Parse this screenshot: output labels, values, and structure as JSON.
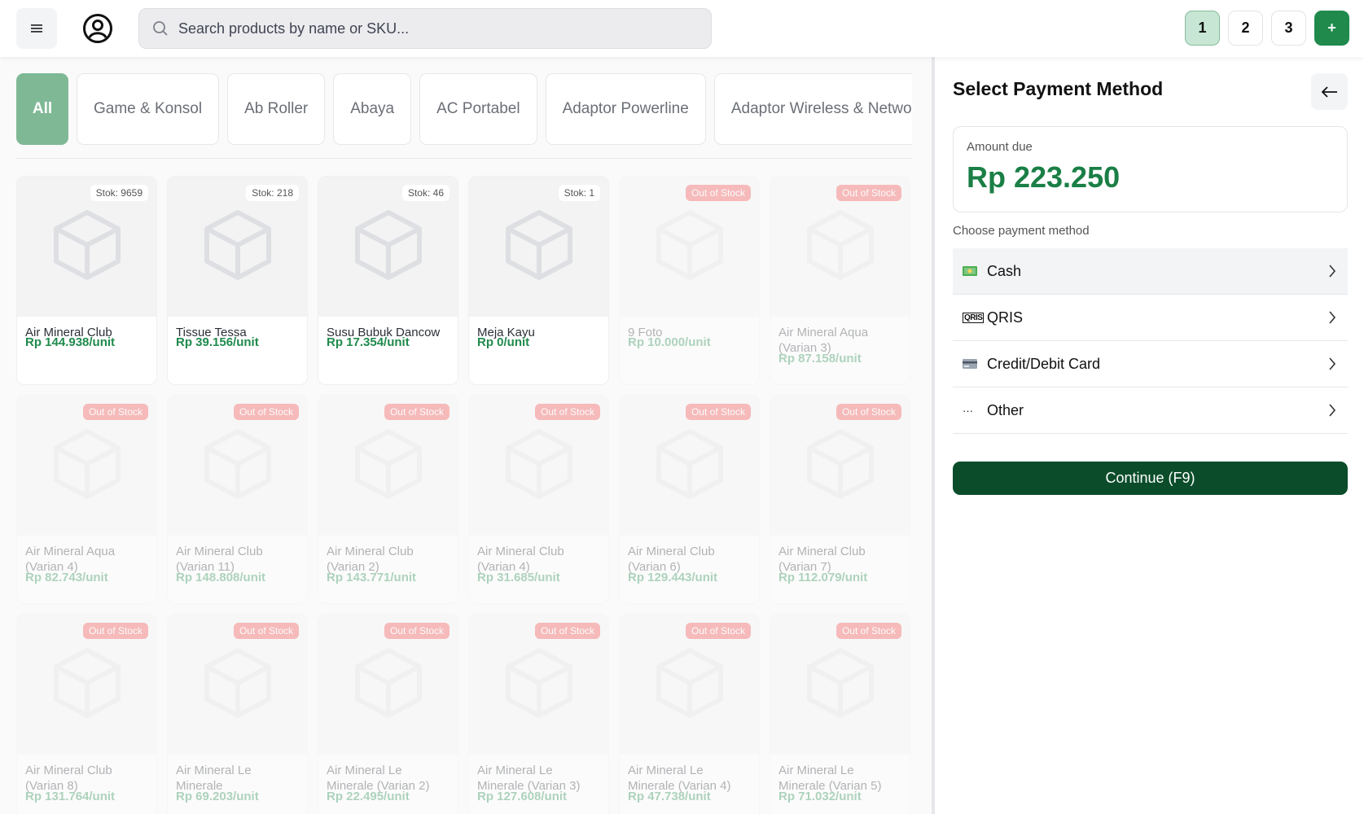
{
  "header": {
    "search_placeholder": "Search products by name or SKU...",
    "tabs": [
      {
        "label": "1",
        "active": true
      },
      {
        "label": "2"
      },
      {
        "label": "3"
      },
      {
        "label": "+"
      }
    ]
  },
  "categories": [
    "All",
    "Game & Konsol",
    "Ab Roller",
    "Abaya",
    "AC Portabel",
    "Adaptor Powerline",
    "Adaptor Wireless & Network"
  ],
  "products": [
    {
      "name": "Air Mineral Club",
      "price": "Rp 144.938/unit",
      "badge": "Stok: 9659",
      "oos": false
    },
    {
      "name": "Tissue Tessa",
      "price": "Rp 39.156/unit",
      "badge": "Stok: 218",
      "oos": false
    },
    {
      "name": "Susu Bubuk Dancow",
      "price": "Rp 17.354/unit",
      "badge": "Stok: 46",
      "oos": false
    },
    {
      "name": "Meja Kayu",
      "price": "Rp 0/unit",
      "badge": "Stok: 1",
      "oos": false
    },
    {
      "name": "9 Foto",
      "price": "Rp 10.000/unit",
      "badge": "Out of Stock",
      "oos": true
    },
    {
      "name": "Air Mineral Aqua (Varian 3)",
      "price": "Rp 87.158/unit",
      "badge": "Out of Stock",
      "oos": true
    },
    {
      "name": "Air Mineral Aqua (Varian 4)",
      "price": "Rp 82.743/unit",
      "badge": "Out of Stock",
      "oos": true
    },
    {
      "name": "Air Mineral Club (Varian 11)",
      "price": "Rp 148.808/unit",
      "badge": "Out of Stock",
      "oos": true
    },
    {
      "name": "Air Mineral Club (Varian 2)",
      "price": "Rp 143.771/unit",
      "badge": "Out of Stock",
      "oos": true
    },
    {
      "name": "Air Mineral Club (Varian 4)",
      "price": "Rp 31.685/unit",
      "badge": "Out of Stock",
      "oos": true
    },
    {
      "name": "Air Mineral Club (Varian 6)",
      "price": "Rp 129.443/unit",
      "badge": "Out of Stock",
      "oos": true
    },
    {
      "name": "Air Mineral Club (Varian 7)",
      "price": "Rp 112.079/unit",
      "badge": "Out of Stock",
      "oos": true
    },
    {
      "name": "Air Mineral Club (Varian 8)",
      "price": "Rp 131.764/unit",
      "badge": "Out of Stock",
      "oos": true
    },
    {
      "name": "Air Mineral Le Minerale",
      "price": "Rp 69.203/unit",
      "badge": "Out of Stock",
      "oos": true
    },
    {
      "name": "Air Mineral Le Minerale (Varian 2)",
      "price": "Rp 22.495/unit",
      "badge": "Out of Stock",
      "oos": true
    },
    {
      "name": "Air Mineral Le Minerale (Varian 3)",
      "price": "Rp 127.608/unit",
      "badge": "Out of Stock",
      "oos": true
    },
    {
      "name": "Air Mineral Le Minerale (Varian 4)",
      "price": "Rp 47.738/unit",
      "badge": "Out of Stock",
      "oos": true
    },
    {
      "name": "Air Mineral Le Minerale (Varian 5)",
      "price": "Rp 71.032/unit",
      "badge": "Out of Stock",
      "oos": true
    }
  ],
  "payment": {
    "title": "Select Payment Method",
    "amount_label": "Amount due",
    "amount_value": "Rp 223.250",
    "choose_label": "Choose payment method",
    "methods": [
      {
        "label": "Cash",
        "icon": "cash-icon"
      },
      {
        "label": "QRIS",
        "icon": "qris-icon",
        "icon_text": "QRIS"
      },
      {
        "label": "Credit/Debit Card",
        "icon": "card-icon"
      },
      {
        "label": "Other",
        "icon": "more-icon",
        "icon_text": "···"
      }
    ],
    "continue_label": "Continue (F9)"
  },
  "colors": {
    "accent": "#1f8a4c",
    "accent_dark": "#0b4d2a",
    "out_of_stock": "#ef4444"
  }
}
